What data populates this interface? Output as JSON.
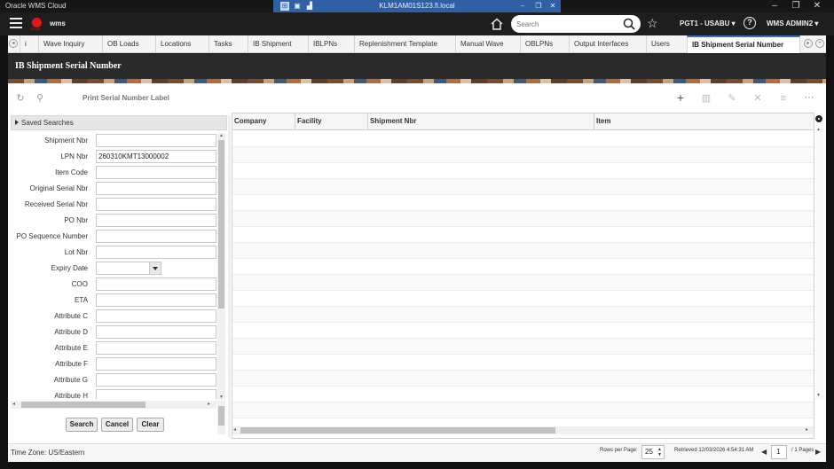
{
  "window": {
    "title": "Oracle WMS Cloud",
    "remote_host": "KLM1AM01S123.fi.local"
  },
  "header": {
    "brand": "wms",
    "search_placeholder": "Search",
    "facility": "PGT1 - USABU",
    "user": "WMS ADMIN2"
  },
  "tabs": [
    {
      "label": "i"
    },
    {
      "label": "Wave Inquiry"
    },
    {
      "label": "OB Loads"
    },
    {
      "label": "Locations"
    },
    {
      "label": "Tasks"
    },
    {
      "label": "IB Shipment"
    },
    {
      "label": "IBLPNs"
    },
    {
      "label": "Replenishment Template"
    },
    {
      "label": "Manual Wave"
    },
    {
      "label": "OBLPNs"
    },
    {
      "label": "Output Interfaces"
    },
    {
      "label": "Users"
    },
    {
      "label": "IB Shipment Serial Number"
    }
  ],
  "page": {
    "title": "IB Shipment Serial Number",
    "print_label": "Print Serial Number Label"
  },
  "search_panel": {
    "saved_searches": "Saved Searches",
    "fields": [
      {
        "label": "Shipment Nbr",
        "value": ""
      },
      {
        "label": "LPN Nbr",
        "value": "260310KMT13000002"
      },
      {
        "label": "Item Code",
        "value": ""
      },
      {
        "label": "Original Serial Nbr",
        "value": ""
      },
      {
        "label": "Received Serial Nbr",
        "value": ""
      },
      {
        "label": "PO Nbr",
        "value": ""
      },
      {
        "label": "PO Sequence Number",
        "value": ""
      },
      {
        "label": "Lot Nbr",
        "value": ""
      },
      {
        "label": "Expiry Date",
        "value": ""
      },
      {
        "label": "COO",
        "value": ""
      },
      {
        "label": "ETA",
        "value": ""
      },
      {
        "label": "Attribute C",
        "value": ""
      },
      {
        "label": "Attribute D",
        "value": ""
      },
      {
        "label": "Attribute E",
        "value": ""
      },
      {
        "label": "Attribute F",
        "value": ""
      },
      {
        "label": "Attribute G",
        "value": ""
      },
      {
        "label": "Attribute H",
        "value": ""
      }
    ],
    "buttons": {
      "search": "Search",
      "cancel": "Cancel",
      "clear": "Clear"
    }
  },
  "grid": {
    "columns": [
      "Company",
      "Facility",
      "Shipment Nbr",
      "Item"
    ]
  },
  "footer": {
    "timezone": "Time Zone: US/Eastern",
    "rows_per_page_label": "Rows per Page:",
    "rows_per_page": "25",
    "retrieved": "Retrieved 12/03/2026 4:54:31 AM",
    "page": "1",
    "pages": "/ 1 Pages"
  }
}
